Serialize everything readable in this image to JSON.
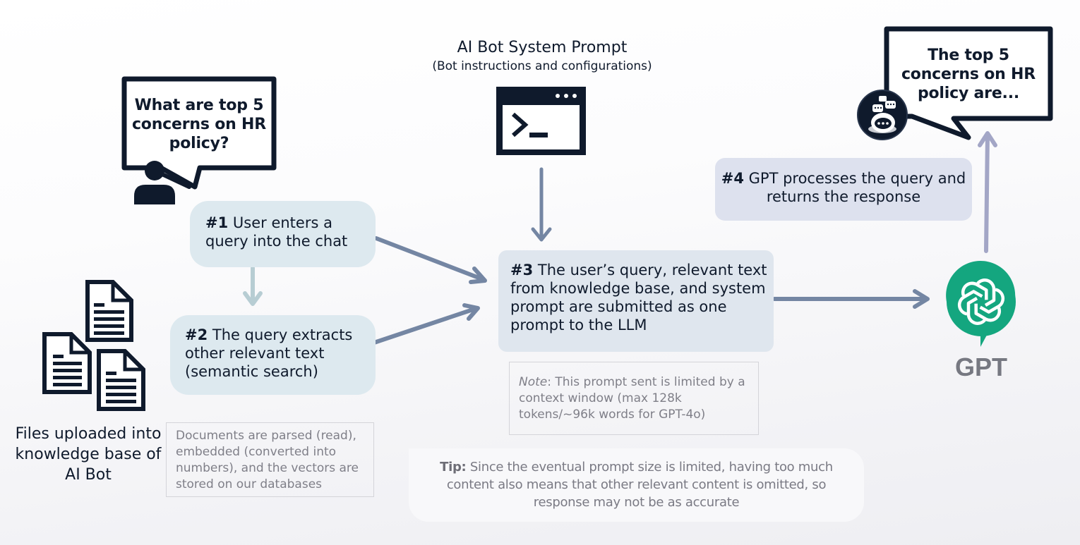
{
  "user_bubble": {
    "text": "What are top 5 concerns on HR policy?"
  },
  "bot_bubble": {
    "text": "The top 5 concerns on HR policy are..."
  },
  "system_prompt": {
    "title": "AI Bot System Prompt",
    "subtitle": "(Bot instructions and configurations)"
  },
  "files": {
    "label": "Files uploaded into knowledge base of AI Bot"
  },
  "steps": [
    {
      "number": "#1",
      "text": "User enters a query into the chat"
    },
    {
      "number": "#2",
      "text": "The query extracts other relevant text (semantic search)"
    },
    {
      "number": "#3",
      "text": "The user’s query, relevant text from knowledge base, and system prompt are submitted as one prompt to the LLM"
    },
    {
      "number": "#4",
      "text": "GPT processes the query and returns the response"
    }
  ],
  "notes": {
    "documents": "Documents are parsed (read), embedded (converted into numbers), and the vectors are stored on our databases",
    "context_label": "Note",
    "context_text": ": This prompt sent is limited by a context window (max 128k tokens/~96k words for GPT-4o)"
  },
  "tip": {
    "label": "Tip:",
    "text": " Since the eventual prompt size is limited, having too much content also means that other relevant content is omitted, so response may not be as accurate"
  },
  "gpt": {
    "label": "GPT",
    "brand_color": "#14a67f"
  },
  "colors": {
    "ink": "#0f1a2c",
    "arrow": "#7486a3",
    "arrow_light": "#b7cdd3",
    "arrow_up": "#a3a6c6"
  }
}
